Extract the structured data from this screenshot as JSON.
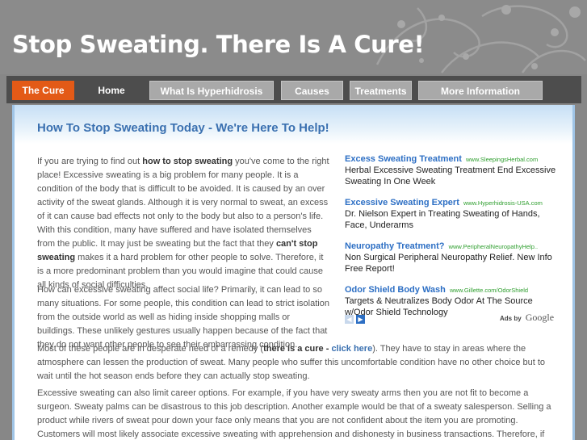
{
  "site": {
    "title": "Stop Sweating. There Is A Cure!"
  },
  "nav": {
    "items": [
      {
        "label": "The Cure"
      },
      {
        "label": "Home"
      },
      {
        "label": "What Is Hyperhidrosis"
      },
      {
        "label": "Causes"
      },
      {
        "label": "Treatments"
      },
      {
        "label": "More Information"
      }
    ]
  },
  "main": {
    "heading": "How To Stop Sweating Today - We're Here To Help!",
    "p1": {
      "a": "If you are trying to find out ",
      "b": "how to stop sweating",
      "c": " you've come to the right place! Excessive sweating is a big problem for many people. It is a condition of the body that is difficult to be avoided. It is caused by an over activity of the sweat glands. Although it is very normal to sweat, an excess of it can cause bad effects not only to the body but also to a person's life. With this condition, many have suffered and have isolated themselves from the public. It may just be sweating but the fact that they ",
      "d": "can't stop sweating",
      "e": " makes it a hard problem for other people to solve. Therefore, it is a more predominant problem than you would imagine that could cause all kinds of social difficulties."
    },
    "p2": {
      "a": "How can excessive sweating affect social life? Primarily, it can lead to so many situations. For some people, this condition can lead to strict isolation from the outside world as well as hiding inside shopping malls or buildings. These unlikely gestures usually happen because of the fact that they do not want other people to see their embarrassing condition.",
      "b": "Most of these people are in desperate need of a remedy (",
      "c": "there is a cure - ",
      "d": "click here",
      "e": "). They have to stay in areas where the atmosphere can lessen the production of sweat. Many people who suffer this uncomfortable condition have no other choice but to wait until the hot season ends before they can actually stop sweating."
    },
    "p3": "Excessive sweating can also limit career options. For example, if you have very sweaty arms then you are not fit to become a surgeon. Sweaty palms can be disastrous to this job description. Another example would be that of a sweaty salesperson. Selling a product while rivers of sweat pour down your face only means that you are not confident about the item you are promoting. Customers will most likely associate excessive sweating with apprehension and dishonesty in business transactions. Therefore, if"
  },
  "ads": {
    "items": [
      {
        "title": "Excess Sweating Treatment",
        "url": "www.SleepingsHerbal.com",
        "text": "Herbal Excessive Sweating Treatment End Excessive Sweating In One Week"
      },
      {
        "title": "Excessive Sweating Expert",
        "url": "www.Hyperhidrosis-USA.com",
        "text": "Dr. Nielson Expert in Treating Sweating of Hands, Face, Underarms"
      },
      {
        "title": "Neuropathy Treatment?",
        "url": "www.PeripheralNeuropathyHelp..",
        "text": "Non Surgical Peripheral Neuropathy Relief. New Info Free Report!"
      },
      {
        "title": "Odor Shield Body Wash",
        "url": "www.Gillette.com/OdorShield",
        "text": "Targets & Neutralizes Body Odor At The Source w/Odor Shield Technology"
      }
    ],
    "ads_by": "Ads by",
    "google": "Google",
    "prev_icon": "◀",
    "next_icon": "▶"
  }
}
